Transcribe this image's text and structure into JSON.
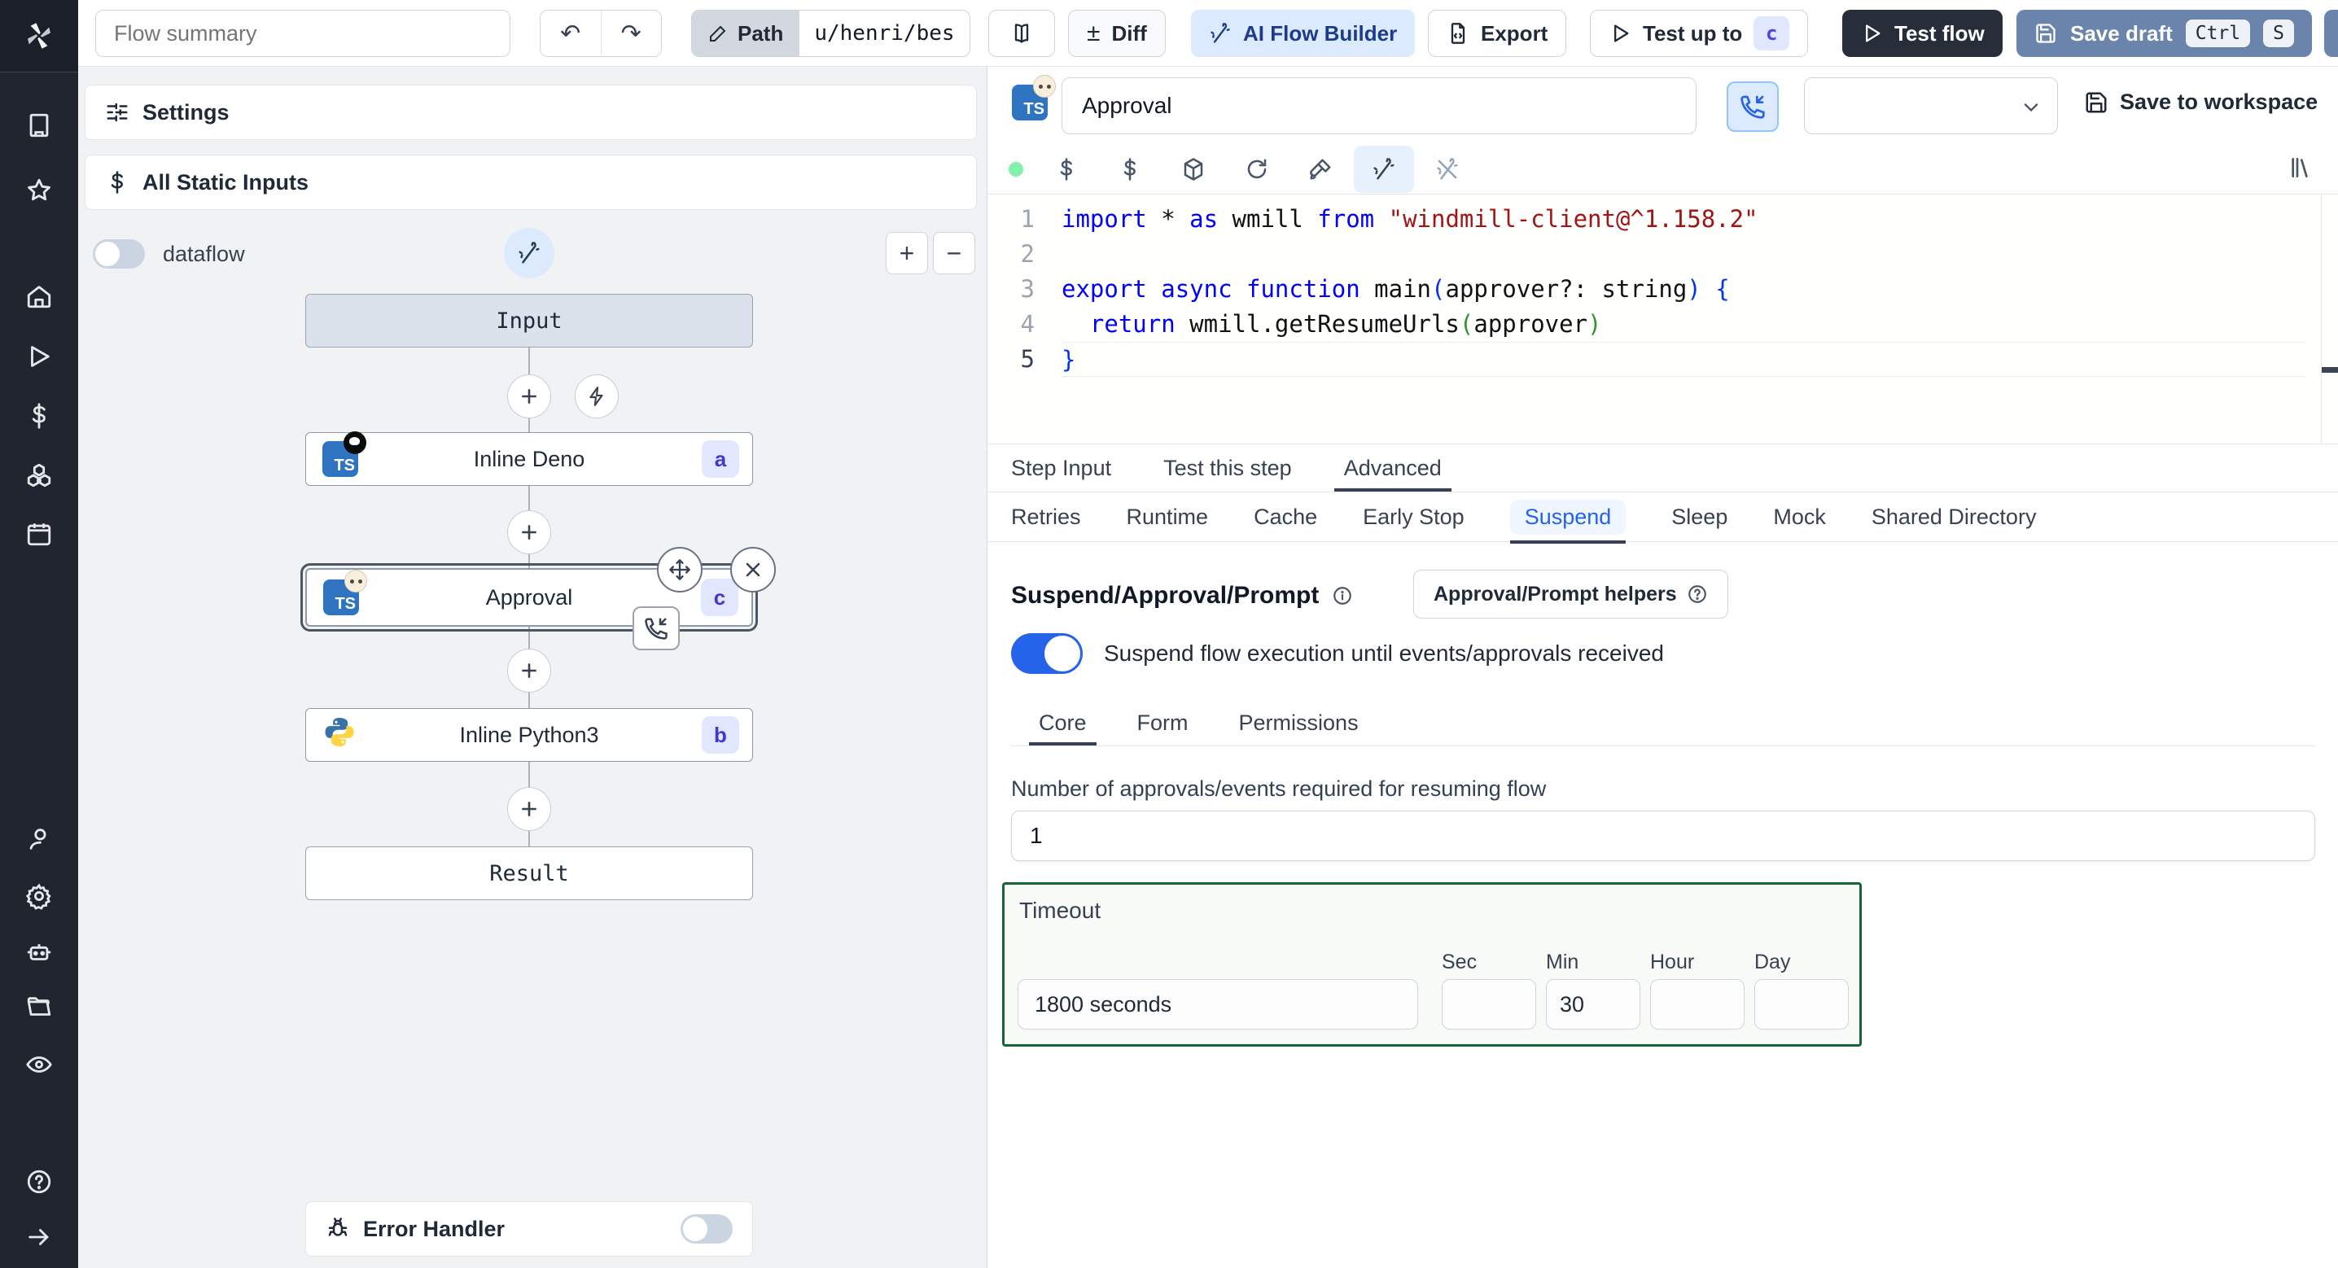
{
  "toolbar": {
    "flow_summary_placeholder": "Flow summary",
    "undo": "↶",
    "redo": "↷",
    "path_label": "Path",
    "path_value": "u/henri/bes",
    "diff_sign": "±",
    "diff_label": "Diff",
    "ai_builder_label": "AI Flow Builder",
    "export_label": "Export",
    "test_up_to_label": "Test up to",
    "test_up_to_badge": "c",
    "test_flow_label": "Test flow",
    "save_draft_label": "Save draft",
    "kbd_ctrl": "Ctrl",
    "kbd_s": "S"
  },
  "flow_panel": {
    "settings_label": "Settings",
    "static_inputs_label": "All Static Inputs",
    "dataflow_label": "dataflow",
    "zoom_in": "+",
    "zoom_out": "−",
    "nodes": {
      "input_label": "Input",
      "deno_label": "Inline Deno",
      "deno_badge": "a",
      "deno_ts": "TS",
      "approval_label": "Approval",
      "approval_badge": "c",
      "approval_ts": "TS",
      "python_label": "Inline Python3",
      "python_badge": "b",
      "result_label": "Result"
    },
    "error_handler_label": "Error Handler"
  },
  "right_panel": {
    "step_name_value": "Approval",
    "ts_text": "TS",
    "save_to_workspace_label": "Save to workspace",
    "code": {
      "lines": [
        [
          {
            "t": "import",
            "c": "kw"
          },
          {
            "t": " * "
          },
          {
            "t": "as",
            "c": "kw"
          },
          {
            "t": " wmill "
          },
          {
            "t": "from",
            "c": "kw"
          },
          {
            "t": " "
          },
          {
            "t": "\"windmill-client@^1.158.2\"",
            "c": "str"
          }
        ],
        [],
        [
          {
            "t": "export",
            "c": "kw"
          },
          {
            "t": " "
          },
          {
            "t": "async",
            "c": "kw"
          },
          {
            "t": " "
          },
          {
            "t": "function",
            "c": "kw"
          },
          {
            "t": " main"
          },
          {
            "t": "(",
            "c": "pb"
          },
          {
            "t": "approver?: string"
          },
          {
            "t": ")",
            "c": "pb"
          },
          {
            "t": " "
          },
          {
            "t": "{",
            "c": "pb"
          }
        ],
        [
          {
            "t": "  "
          },
          {
            "t": "return",
            "c": "kw"
          },
          {
            "t": " wmill.getResumeUrls"
          },
          {
            "t": "(",
            "c": "pg"
          },
          {
            "t": "approver"
          },
          {
            "t": ")",
            "c": "pg"
          }
        ],
        [
          {
            "t": "}",
            "c": "pb"
          }
        ]
      ]
    },
    "tabs_main": [
      {
        "label": "Step Input"
      },
      {
        "label": "Test this step"
      },
      {
        "label": "Advanced"
      }
    ],
    "tabs_advanced": [
      {
        "label": "Retries"
      },
      {
        "label": "Runtime"
      },
      {
        "label": "Cache"
      },
      {
        "label": "Early Stop"
      },
      {
        "label": "Suspend"
      },
      {
        "label": "Sleep"
      },
      {
        "label": "Mock"
      },
      {
        "label": "Shared Directory"
      }
    ],
    "suspend": {
      "title": "Suspend/Approval/Prompt",
      "helpers_label": "Approval/Prompt helpers",
      "toggle_label": "Suspend flow execution until events/approvals received",
      "tabs": [
        {
          "label": "Core"
        },
        {
          "label": "Form"
        },
        {
          "label": "Permissions"
        }
      ],
      "approvals_label": "Number of approvals/events required for resuming flow",
      "approvals_value": "1",
      "timeout_label": "Timeout",
      "timeout_value": "1800 seconds",
      "unit_sec": "Sec",
      "unit_min": "Min",
      "unit_hour": "Hour",
      "unit_day": "Day",
      "min_value": "30"
    }
  },
  "colors": {
    "accent_blue": "#2563eb",
    "ai_button_bg": "#dbeafe",
    "save_draft_bg": "#6b84ab",
    "dark_button_bg": "#272e3a",
    "badge_bg": "#e0e7ff",
    "badge_text": "#4338ca",
    "timeout_border": "#166534",
    "keyword": "#0000ff",
    "string": "#a31515"
  }
}
